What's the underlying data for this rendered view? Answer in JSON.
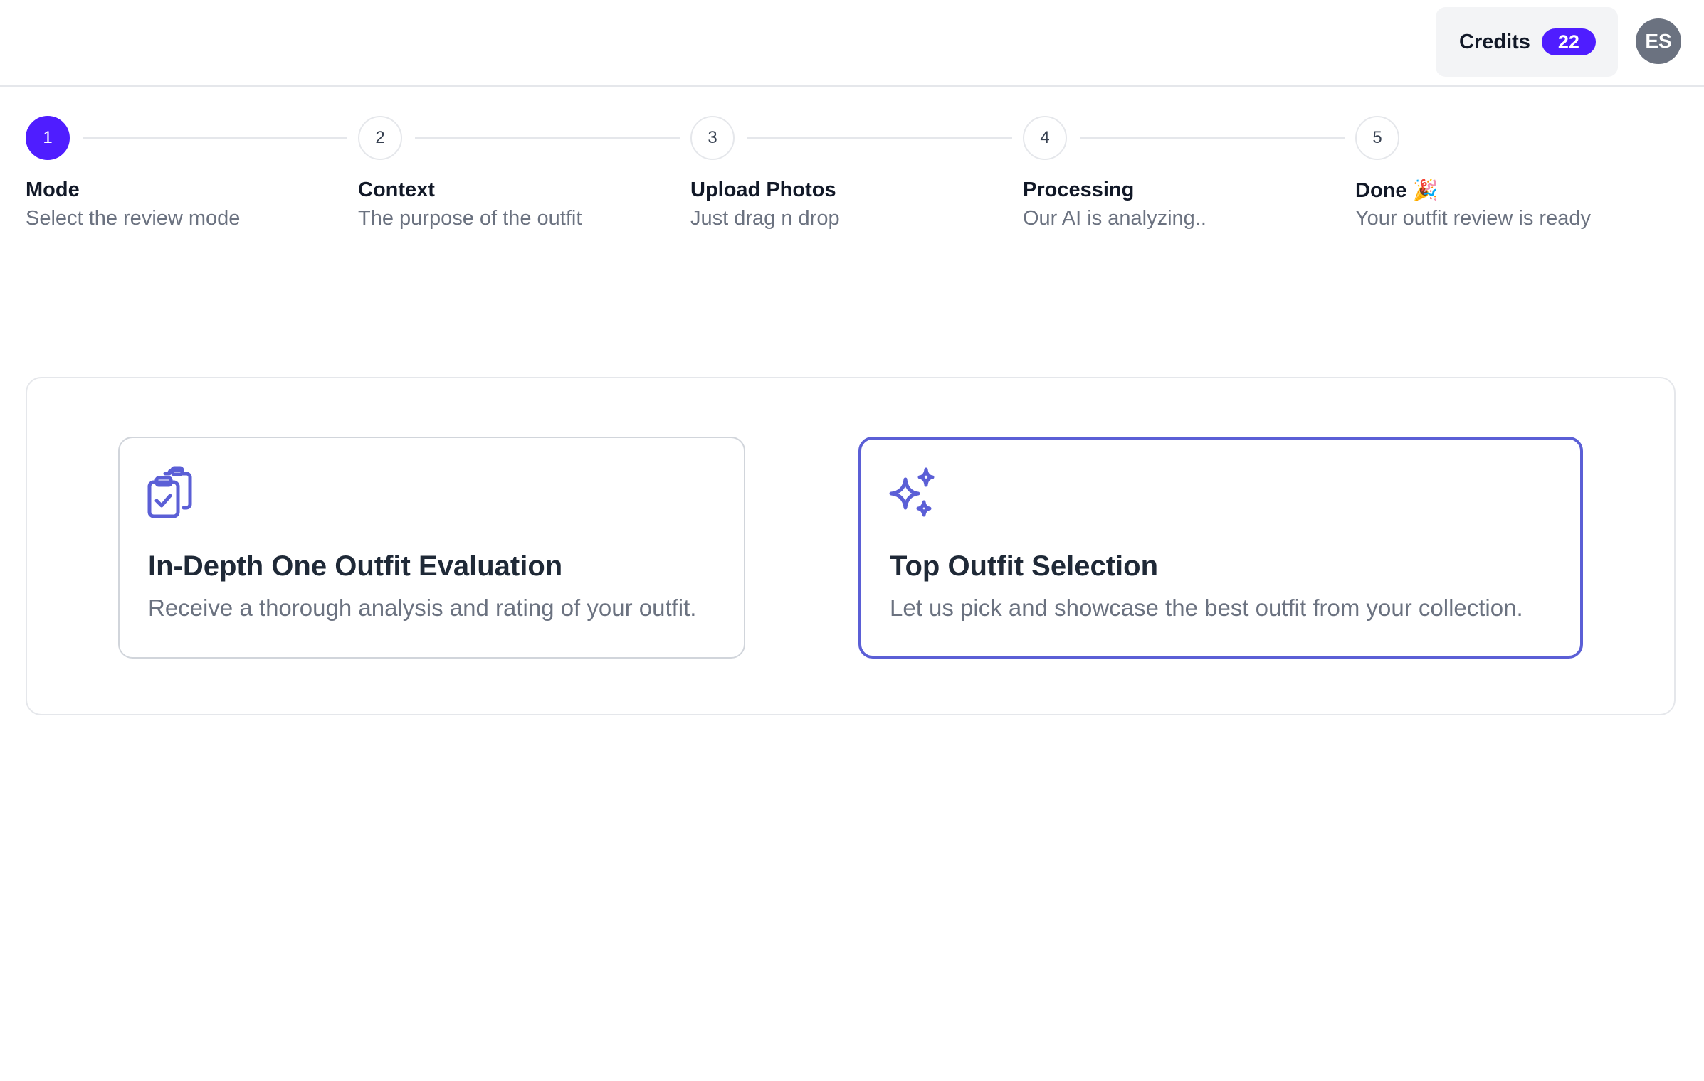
{
  "header": {
    "credits_label": "Credits",
    "credits_count": "22",
    "avatar_initials": "ES"
  },
  "stepper": {
    "active_step": 1,
    "steps": [
      {
        "number": "1",
        "title": "Mode",
        "subtitle": "Select the review mode"
      },
      {
        "number": "2",
        "title": "Context",
        "subtitle": "The purpose of the outfit"
      },
      {
        "number": "3",
        "title": "Upload Photos",
        "subtitle": "Just drag n drop"
      },
      {
        "number": "4",
        "title": "Processing",
        "subtitle": "Our AI is analyzing.."
      },
      {
        "number": "5",
        "title": "Done 🎉",
        "subtitle": "Your outfit review is ready"
      }
    ]
  },
  "modes": [
    {
      "icon": "clipboard-check-icon",
      "title": "In-Depth One Outfit Evaluation",
      "description": "Receive a thorough analysis and rating of your outfit."
    },
    {
      "icon": "sparkles-icon",
      "title": "Top Outfit Selection",
      "description": "Let us pick and showcase the best outfit from your collection."
    }
  ],
  "colors": {
    "accent": "#4f1dff",
    "selected_border": "#5b5fd6",
    "icon": "#5b5fd6",
    "muted_text": "#6b7280",
    "border": "#e5e7eb"
  }
}
